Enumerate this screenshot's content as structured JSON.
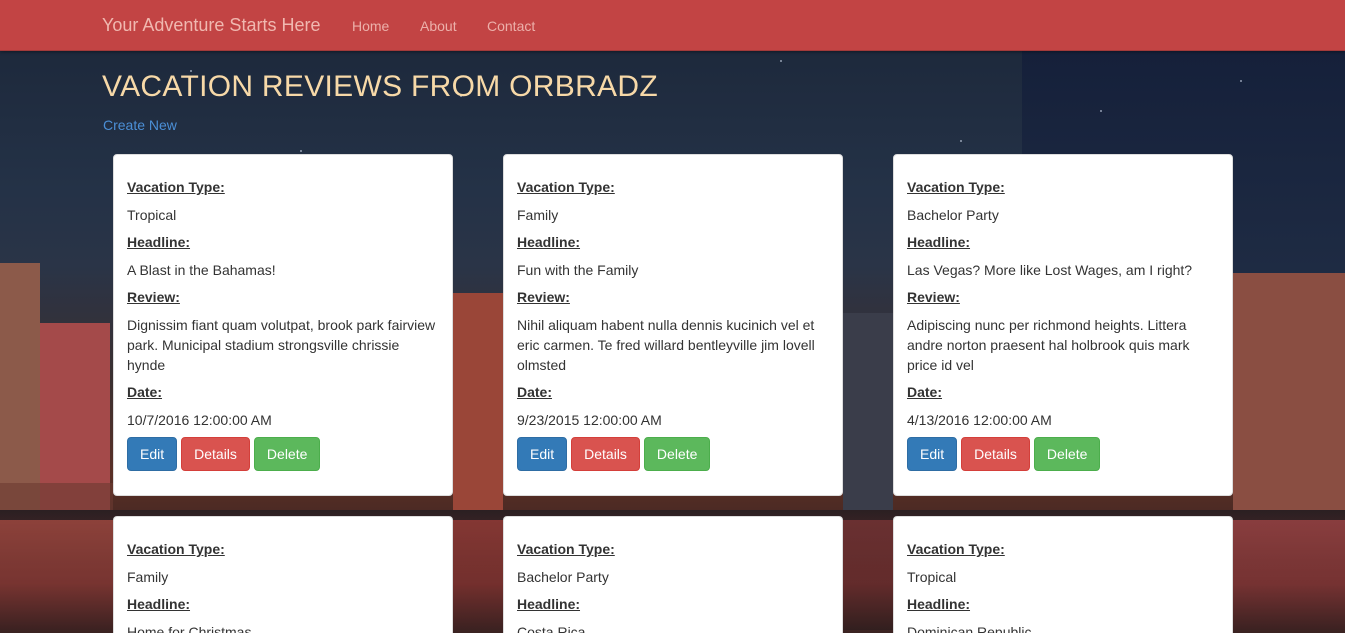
{
  "navbar": {
    "brand": "Your Adventure Starts Here",
    "links": [
      "Home",
      "About",
      "Contact"
    ]
  },
  "page": {
    "title": "VACATION REVIEWS FROM ORBRADZ",
    "create_link": "Create New"
  },
  "labels": {
    "type": "Vacation Type:",
    "headline": "Headline:",
    "review": "Review:",
    "date": "Date:"
  },
  "buttons": {
    "edit": "Edit",
    "details": "Details",
    "delete": "Delete"
  },
  "reviews": [
    {
      "type": "Tropical",
      "headline": "A Blast in the Bahamas!",
      "review": "Dignissim fiant quam volutpat, brook park fairview park. Municipal stadium strongsville chrissie hynde",
      "date": "10/7/2016 12:00:00 AM"
    },
    {
      "type": "Family",
      "headline": "Fun with the Family",
      "review": "Nihil aliquam habent nulla dennis kucinich vel et eric carmen. Te fred willard bentleyville jim lovell olmsted",
      "date": "9/23/2015 12:00:00 AM"
    },
    {
      "type": "Bachelor Party",
      "headline": "Las Vegas? More like Lost Wages, am I right?",
      "review": "Adipiscing nunc per richmond heights. Littera andre norton praesent hal holbrook quis mark price id vel",
      "date": "4/13/2016 12:00:00 AM"
    },
    {
      "type": "Family",
      "headline": "Home for Christmas"
    },
    {
      "type": "Bachelor Party",
      "headline": "Costa Rica"
    },
    {
      "type": "Tropical",
      "headline": "Dominican Republic"
    }
  ],
  "colors": {
    "navbar": "#c24444",
    "title": "#f7d9a8",
    "link": "#4b8fd6",
    "edit": "#337ab7",
    "details": "#d9534f",
    "delete": "#5cb85c"
  }
}
